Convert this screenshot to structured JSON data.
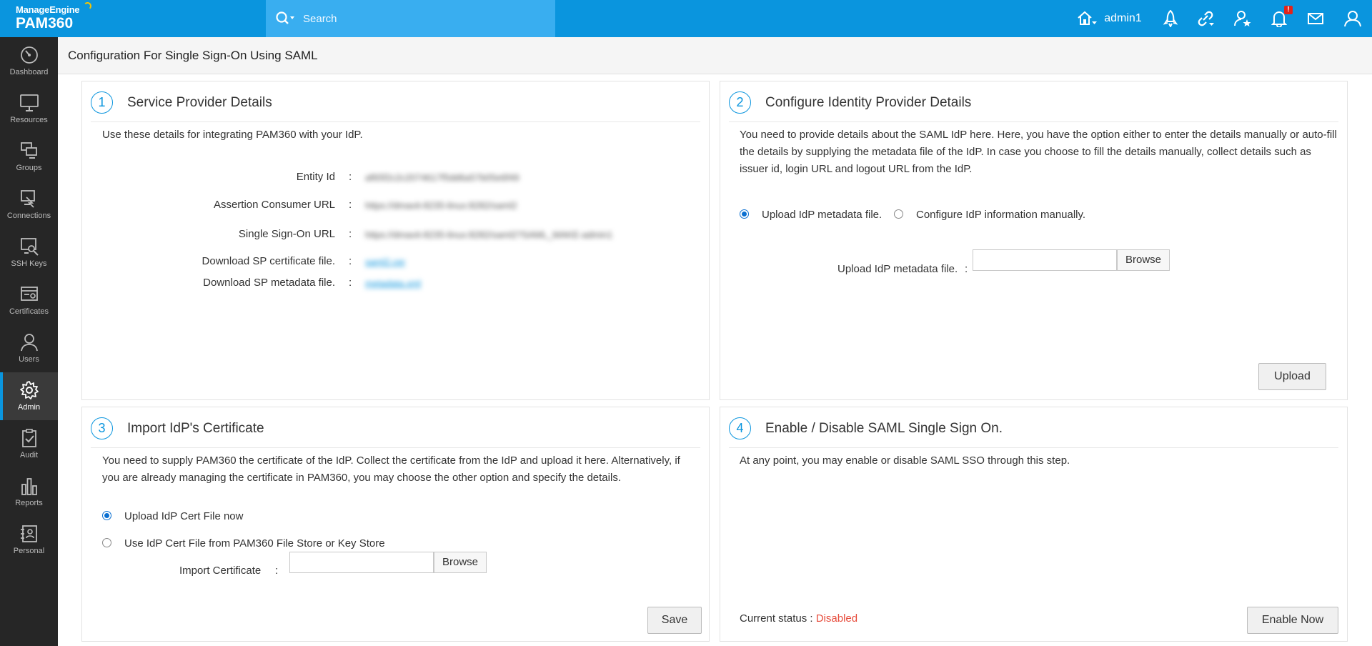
{
  "topbar": {
    "brand": "ManageEngine",
    "product": "PAM360",
    "search_placeholder": "Search",
    "user": "admin1",
    "notification_badge": "!"
  },
  "sidebar": {
    "items": [
      {
        "label": "Dashboard",
        "icon": "gauge-icon"
      },
      {
        "label": "Resources",
        "icon": "monitor-icon"
      },
      {
        "label": "Groups",
        "icon": "groups-icon"
      },
      {
        "label": "Connections",
        "icon": "connections-icon"
      },
      {
        "label": "SSH Keys",
        "icon": "ssh-key-icon"
      },
      {
        "label": "Certificates",
        "icon": "certificate-icon"
      },
      {
        "label": "Users",
        "icon": "user-icon"
      },
      {
        "label": "Admin",
        "icon": "gear-icon",
        "active": true
      },
      {
        "label": "Audit",
        "icon": "clipboard-check-icon"
      },
      {
        "label": "Reports",
        "icon": "bar-chart-icon"
      },
      {
        "label": "Personal",
        "icon": "contact-card-icon"
      }
    ]
  },
  "page": {
    "title": "Configuration For Single Sign-On Using SAML"
  },
  "panel1": {
    "number": "1",
    "title": "Service Provider Details",
    "description": "Use these details for integrating PAM360 with your IdP.",
    "rows": [
      {
        "label": "Entity Id",
        "value": "af65f2c2c2074617f5dd6a57b05e6f49"
      },
      {
        "label": "Assertion Consumer URL",
        "value": "https://dmavit-8235-linux:8282/saml2"
      },
      {
        "label": "Single Sign-On URL",
        "value": "https://dmavit-8235-linux:8282/saml2?SAML_MAKE-admin1"
      },
      {
        "label": "Download SP certificate file.",
        "value": "saml2.cer"
      },
      {
        "label": "Download SP metadata file.",
        "value": "metadata.xml"
      }
    ]
  },
  "panel2": {
    "number": "2",
    "title": "Configure Identity Provider Details",
    "description": "You need to provide details about the SAML IdP here. Here, you have the option either to enter the details manually or auto-fill the details by supplying the metadata file of the IdP. In case you choose to fill the details manually, collect details such as issuer id, login URL and logout URL from the IdP.",
    "option_upload": "Upload IdP metadata file.",
    "option_manual": "Configure IdP information manually.",
    "file_label": "Upload IdP metadata file.",
    "browse_label": "Browse",
    "upload_button": "Upload"
  },
  "panel3": {
    "number": "3",
    "title": "Import IdP's Certificate",
    "description": "You need to supply PAM360 the certificate of the IdP. Collect the certificate from the IdP and upload it here. Alternatively, if you are already managing the certificate in PAM360, you may choose the other option and specify the details.",
    "option_upload": "Upload IdP Cert File now",
    "option_store": "Use IdP Cert File from PAM360 File Store or Key Store",
    "file_label": "Import Certificate",
    "browse_label": "Browse",
    "save_button": "Save"
  },
  "panel4": {
    "number": "4",
    "title": "Enable / Disable SAML Single Sign On.",
    "description": "At any point, you may enable or disable SAML SSO through this step.",
    "status_label": "Current status :",
    "status_value": "Disabled",
    "enable_button": "Enable Now"
  },
  "colors": {
    "accent": "#0a95de",
    "sidebar": "#262626",
    "disabled_status": "#e74c3c"
  }
}
